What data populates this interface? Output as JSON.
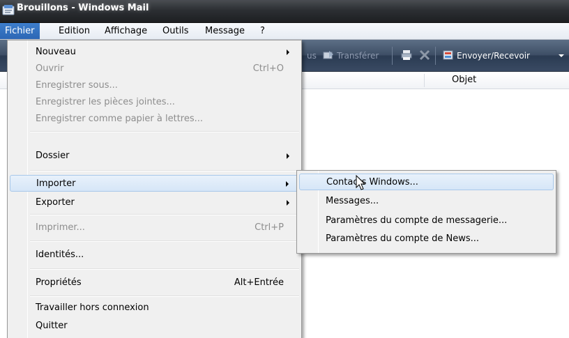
{
  "window": {
    "title": "Brouillons - Windows Mail"
  },
  "menubar": {
    "items": [
      "Fichier",
      "Edition",
      "Affichage",
      "Outils",
      "Message",
      "?"
    ]
  },
  "toolbar": {
    "partial_label": "us",
    "forward_label": "Transférer",
    "send_receive_label": "Envoyer/Recevoir"
  },
  "list": {
    "col_objet": "Objet"
  },
  "file_menu": {
    "items": [
      {
        "label": "Nouveau",
        "shortcut": "",
        "submenu": true,
        "disabled": false
      },
      {
        "label": "Ouvrir",
        "shortcut": "Ctrl+O",
        "submenu": false,
        "disabled": true
      },
      {
        "label": "Enregistrer sous...",
        "shortcut": "",
        "submenu": false,
        "disabled": true
      },
      {
        "label": "Enregistrer les pièces jointes...",
        "shortcut": "",
        "submenu": false,
        "disabled": true
      },
      {
        "label": "Enregistrer comme papier à lettres...",
        "shortcut": "",
        "submenu": false,
        "disabled": true
      },
      {
        "label": "Dossier",
        "shortcut": "",
        "submenu": true,
        "disabled": false
      },
      {
        "label": "Importer",
        "shortcut": "",
        "submenu": true,
        "disabled": false,
        "highlighted": true
      },
      {
        "label": "Exporter",
        "shortcut": "",
        "submenu": true,
        "disabled": false
      },
      {
        "label": "Imprimer...",
        "shortcut": "Ctrl+P",
        "submenu": false,
        "disabled": true
      },
      {
        "label": "Identités...",
        "shortcut": "",
        "submenu": false,
        "disabled": false
      },
      {
        "label": "Propriétés",
        "shortcut": "Alt+Entrée",
        "submenu": false,
        "disabled": false
      },
      {
        "label": "Travailler hors connexion",
        "shortcut": "",
        "submenu": false,
        "disabled": false
      },
      {
        "label": "Quitter",
        "shortcut": "",
        "submenu": false,
        "disabled": false
      }
    ]
  },
  "import_submenu": {
    "items": [
      {
        "label": "Contacts Windows...",
        "highlighted": true
      },
      {
        "label": "Messages..."
      },
      {
        "label": "Paramètres du compte de messagerie..."
      },
      {
        "label": "Paramètres du compte de News..."
      }
    ]
  },
  "colors": {
    "menu_active": "#2c66b5",
    "highlight_border": "#a8c8ea",
    "disabled_text": "#8d8d8d"
  }
}
